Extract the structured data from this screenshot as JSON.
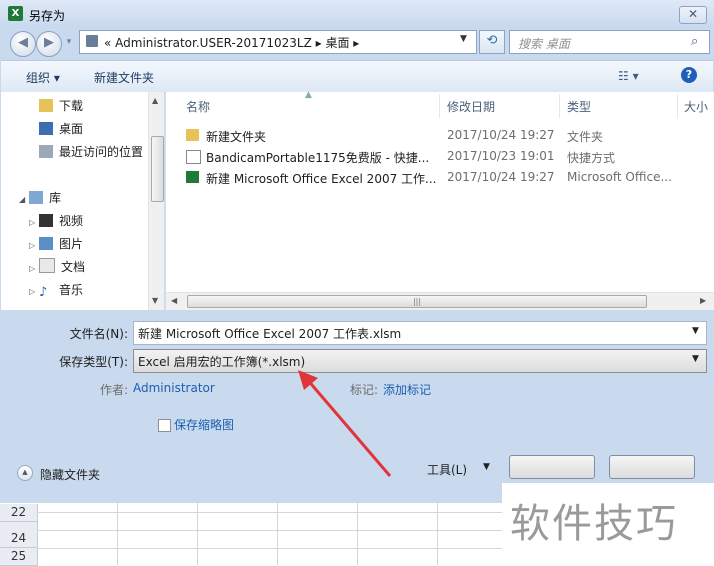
{
  "window": {
    "title": "另存为",
    "app_icon_letter": "X",
    "close_glyph": "✕"
  },
  "nav": {
    "address_path": "« Administrator.USER-20171023LZ ▸ 桌面 ▸",
    "search_placeholder": "搜索 桌面"
  },
  "toolbar": {
    "organize_label": "组织 ▾",
    "new_folder_label": "新建文件夹"
  },
  "sidebar": {
    "items": [
      {
        "label": "下载",
        "icon": "download-folder-icon"
      },
      {
        "label": "桌面",
        "icon": "desktop-icon"
      },
      {
        "label": "最近访问的位置",
        "icon": "recent-places-icon"
      },
      {
        "label": "库",
        "icon": "library-icon"
      },
      {
        "label": "视频",
        "icon": "video-icon"
      },
      {
        "label": "图片",
        "icon": "pictures-icon"
      },
      {
        "label": "文档",
        "icon": "documents-icon"
      },
      {
        "label": "音乐",
        "icon": "music-icon"
      }
    ]
  },
  "file_list": {
    "columns": [
      "名称",
      "修改日期",
      "类型",
      "大小"
    ],
    "rows": [
      {
        "name": "新建文件夹",
        "date": "2017/10/24 19:27",
        "type": "文件夹",
        "icon": "folder-icon"
      },
      {
        "name": "BandicamPortable1175免费版 - 快捷...",
        "date": "2017/10/23 19:01",
        "type": "快捷方式",
        "icon": "shortcut-icon"
      },
      {
        "name": "新建 Microsoft Office Excel 2007 工作...",
        "date": "2017/10/24 19:27",
        "type": "Microsoft Office...",
        "icon": "excel-file-icon"
      }
    ]
  },
  "form": {
    "filename_label": "文件名(N):",
    "filename_value": "新建 Microsoft Office Excel 2007 工作表.xlsm",
    "filetype_label": "保存类型(T):",
    "filetype_value": "Excel 启用宏的工作簿(*.xlsm)",
    "author_label": "作者:",
    "author_value": "Administrator",
    "tags_label": "标记:",
    "tags_value": "添加标记",
    "thumbnail_label": "保存缩略图",
    "hide_folders_label": "隐藏文件夹",
    "tools_label": "工具(L)"
  },
  "sheet": {
    "row_numbers": [
      "22",
      "24",
      "25"
    ]
  },
  "watermark_text": "软件技巧",
  "colors": {
    "frame": "#c9daee",
    "link": "#1d5fb0",
    "arrow": "#e0343a"
  }
}
